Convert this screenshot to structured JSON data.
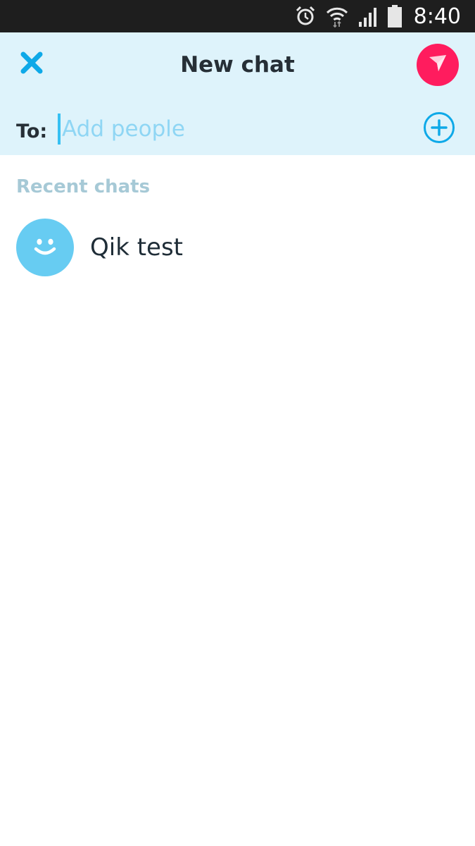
{
  "status_bar": {
    "time": "8:40",
    "icons": [
      "alarm-icon",
      "wifi-icon",
      "signal-icon",
      "battery-icon"
    ]
  },
  "header": {
    "title": "New chat",
    "close_icon": "close-icon",
    "send_icon": "send-icon",
    "to_label": "To:",
    "people_input": {
      "value": "",
      "placeholder": "Add people"
    },
    "add_icon": "add-circle-icon"
  },
  "recent": {
    "label": "Recent chats",
    "items": [
      {
        "name": "Qik test",
        "avatar_icon": "smiley-avatar-icon"
      }
    ]
  },
  "colors": {
    "header_bg": "#def3fb",
    "accent_blue": "#0ea9e8",
    "send_red": "#ff1c5e",
    "avatar_blue": "#67ccf2",
    "section_label": "#a6c9d6"
  }
}
